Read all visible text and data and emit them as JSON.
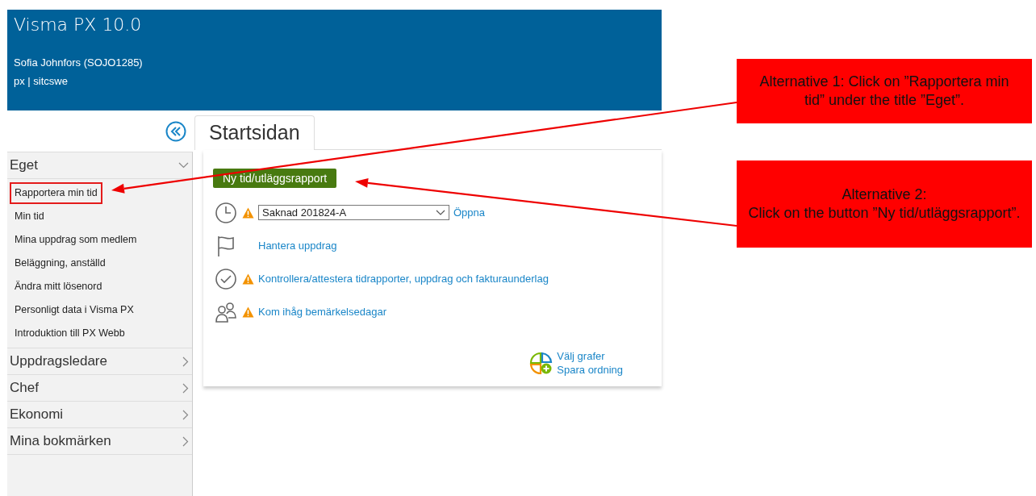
{
  "window": {
    "title": "Visma PX 10.0"
  },
  "header": {
    "user": "Sofia Johnfors (SOJO1285)",
    "context": "px | sitcswe"
  },
  "sidebar": {
    "sections": [
      {
        "label": "Eget",
        "expanded": true,
        "items": [
          {
            "label": "Rapportera min tid",
            "highlighted": true
          },
          {
            "label": "Min tid",
            "highlighted": false
          },
          {
            "label": "Mina uppdrag som medlem",
            "highlighted": false
          },
          {
            "label": "Beläggning, anställd",
            "highlighted": false
          },
          {
            "label": "Ändra mitt lösenord",
            "highlighted": false
          },
          {
            "label": "Personligt data i Visma PX",
            "highlighted": false
          },
          {
            "label": "Introduktion till PX Webb",
            "highlighted": false
          }
        ]
      },
      {
        "label": "Uppdragsledare",
        "expanded": false
      },
      {
        "label": "Chef",
        "expanded": false
      },
      {
        "label": "Ekonomi",
        "expanded": false
      },
      {
        "label": "Mina bokmärken",
        "expanded": false
      }
    ]
  },
  "tabs": [
    {
      "label": "Startsidan",
      "selected": true
    }
  ],
  "content": {
    "primary_button": "Ny tid/utläggsrapport",
    "rows": [
      {
        "kind": "clock",
        "warning": true,
        "select_value": "Saknad 201824-A",
        "link": "Öppna"
      },
      {
        "kind": "flag",
        "warning": false,
        "link": "Hantera uppdrag"
      },
      {
        "kind": "check",
        "warning": true,
        "link": "Kontrollera/attestera tidrapporter, uppdrag och fakturaunderlag"
      },
      {
        "kind": "people",
        "warning": true,
        "link": "Kom ihåg bemärkelsedagar"
      }
    ],
    "chart_links": [
      "Välj grafer",
      "Spara ordning"
    ]
  },
  "callouts": [
    {
      "lines": [
        "Alternative 1: Click on ”Rapportera min tid” under the title ”Eget”."
      ]
    },
    {
      "lines": [
        "Alternative 2:",
        "Click on the button ”Ny tid/utläggsrapport”."
      ]
    }
  ]
}
